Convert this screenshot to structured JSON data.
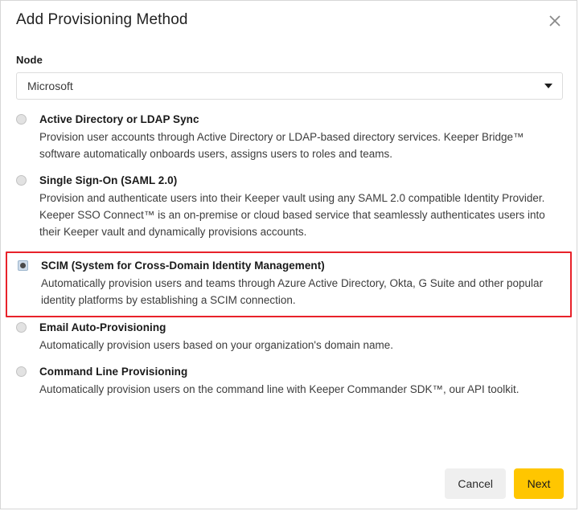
{
  "dialog": {
    "title": "Add Provisioning Method",
    "close_icon": "close-icon"
  },
  "node_field": {
    "label": "Node",
    "selected_value": "Microsoft",
    "caret_icon": "chevron-down-icon"
  },
  "options": [
    {
      "title": "Active Directory or LDAP Sync",
      "description": "Provision user accounts through Active Directory or LDAP-based directory services. Keeper Bridge™ software automatically onboards users, assigns users to roles and teams.",
      "selected": false,
      "highlighted": false
    },
    {
      "title": "Single Sign-On (SAML 2.0)",
      "description": "Provision and authenticate users into their Keeper vault using any SAML 2.0 compatible Identity Provider. Keeper SSO Connect™ is an on-premise or cloud based service that seamlessly authenticates users into their Keeper vault and dynamically provisions accounts.",
      "selected": false,
      "highlighted": false
    },
    {
      "title": "SCIM (System for Cross-Domain Identity Management)",
      "description": "Automatically provision users and teams through Azure Active Directory, Okta, G Suite and other popular identity platforms by establishing a SCIM connection.",
      "selected": true,
      "highlighted": true
    },
    {
      "title": "Email Auto-Provisioning",
      "description": "Automatically provision users based on your organization's domain name.",
      "selected": false,
      "highlighted": false
    },
    {
      "title": "Command Line Provisioning",
      "description": "Automatically provision users on the command line with Keeper Commander SDK™, our API toolkit.",
      "selected": false,
      "highlighted": false
    }
  ],
  "footer": {
    "cancel_label": "Cancel",
    "next_label": "Next"
  },
  "colors": {
    "highlight_border": "#e8222a",
    "primary_button": "#ffc600",
    "secondary_button": "#efefef"
  }
}
